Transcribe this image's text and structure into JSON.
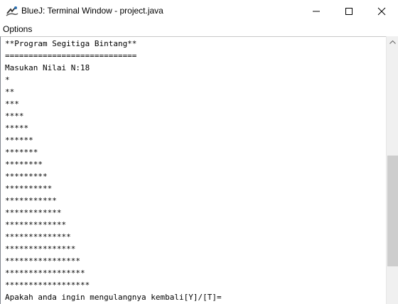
{
  "window": {
    "title": "BlueJ: Terminal Window - project.java",
    "icon": "bluej-icon"
  },
  "menu": {
    "items": [
      "Options"
    ]
  },
  "terminal": {
    "lines": [
      "**Program Segitiga Bintang**",
      "============================",
      "Masukan Nilai N:18",
      "*",
      "**",
      "***",
      "****",
      "*****",
      "******",
      "*******",
      "********",
      "*********",
      "**********",
      "***********",
      "************",
      "*************",
      "**************",
      "***************",
      "****************",
      "*****************",
      "******************",
      "Apakah anda ingin mengulangnya kembali[Y]/[T]="
    ]
  },
  "scrollbar": {
    "position_fraction": 0.52
  }
}
